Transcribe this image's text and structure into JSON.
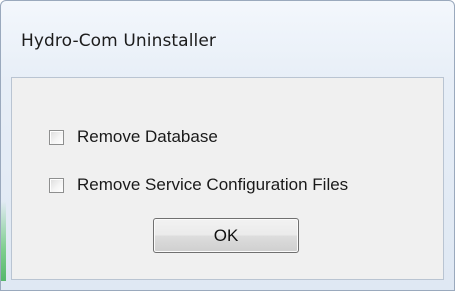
{
  "window": {
    "title": "Hydro-Com Uninstaller"
  },
  "options": [
    {
      "label": "Remove Database",
      "checked": false
    },
    {
      "label": "Remove Service Configuration Files",
      "checked": false
    }
  ],
  "buttons": {
    "ok_label": "OK"
  }
}
